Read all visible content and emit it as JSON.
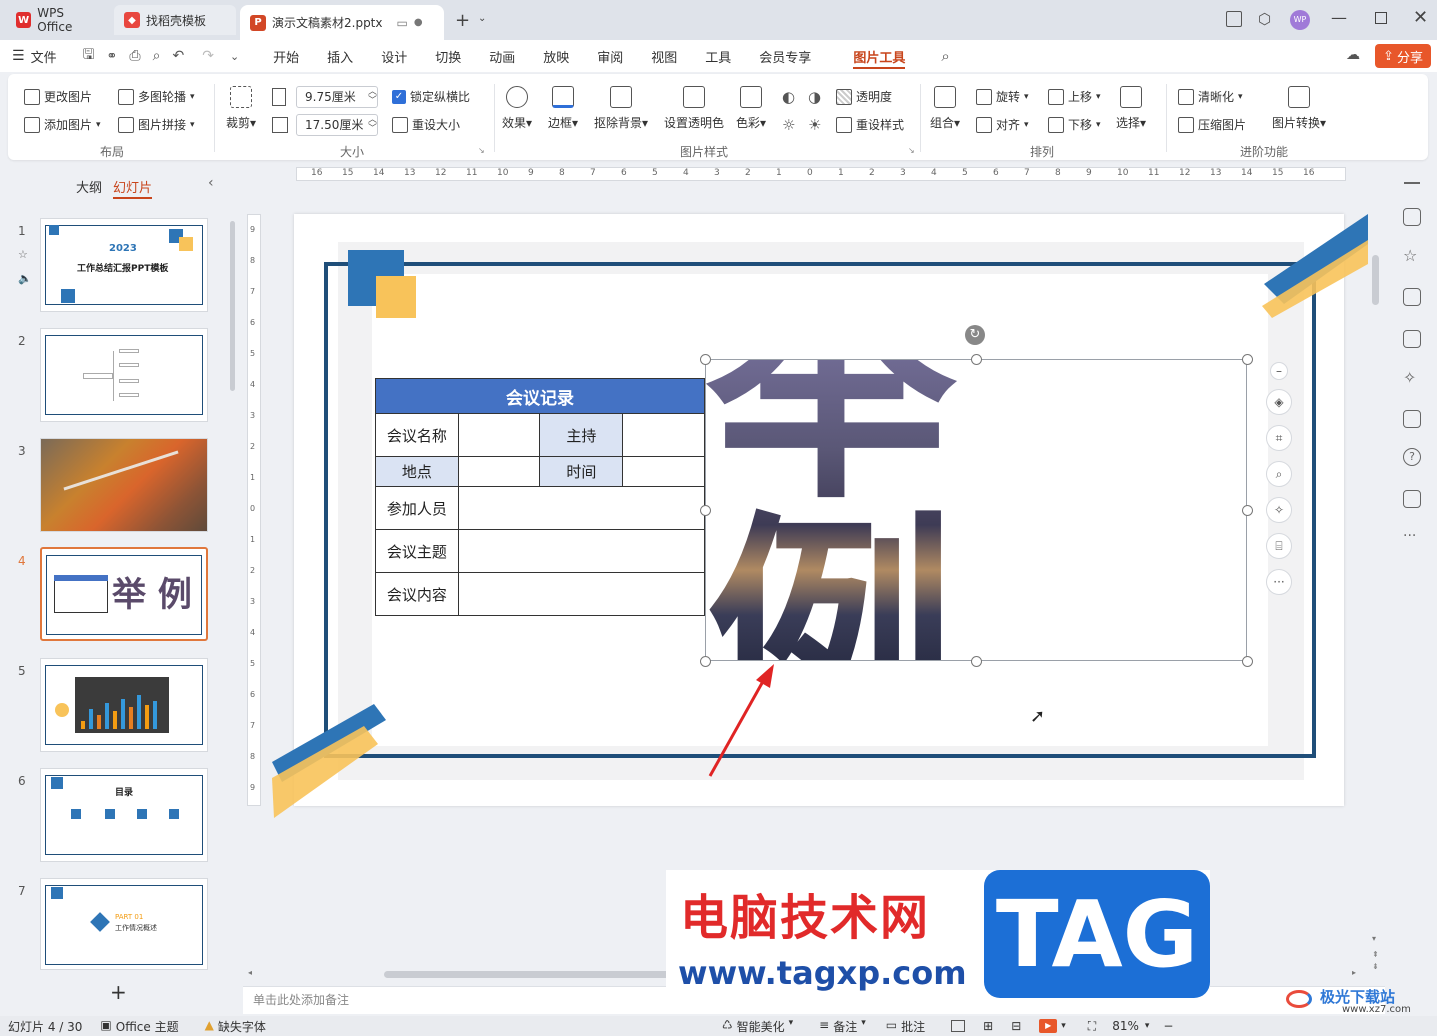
{
  "tabs": [
    {
      "label": "WPS Office"
    },
    {
      "label": "找稻壳模板"
    },
    {
      "label": "演示文稿素材2.pptx"
    }
  ],
  "user_badge": "WP",
  "menu": {
    "file": "文件",
    "items": [
      "开始",
      "插入",
      "设计",
      "切换",
      "动画",
      "放映",
      "审阅",
      "视图",
      "工具",
      "会员专享",
      "图片工具"
    ],
    "share": "分享"
  },
  "ribbon": {
    "change_image": "更改图片",
    "multi_carousel": "多图轮播",
    "add_image": "添加图片",
    "image_collage": "图片拼接",
    "layout_group": "布局",
    "crop": "裁剪",
    "width": "9.75厘米",
    "height": "17.50厘米",
    "lock_ratio": "锁定纵横比",
    "reset_size": "重设大小",
    "size_group": "大小",
    "effect": "效果",
    "border": "边框",
    "remove_bg": "抠除背景",
    "set_transparent": "设置透明色",
    "color": "色彩",
    "transparency": "透明度",
    "reset_style": "重设样式",
    "style_group": "图片样式",
    "group": "组合",
    "rotate": "旋转",
    "align": "对齐",
    "move_up": "上移",
    "move_down": "下移",
    "select": "选择",
    "arrange_group": "排列",
    "sharpen": "清晰化",
    "compress": "压缩图片",
    "convert": "图片转换",
    "advanced_group": "进阶功能"
  },
  "panel": {
    "outline": "大纲",
    "slides": "幻灯片"
  },
  "thumbs": [
    {
      "num": "1",
      "title": "工作总结汇报PPT模板",
      "year": "2023"
    },
    {
      "num": "2"
    },
    {
      "num": "3"
    },
    {
      "num": "4",
      "text": "举 例"
    },
    {
      "num": "5"
    },
    {
      "num": "6",
      "title": "目录"
    },
    {
      "num": "7",
      "title": "PART 01",
      "subtitle": "工作情况概述"
    }
  ],
  "ruler_labels": [
    "16",
    "15",
    "14",
    "13",
    "12",
    "11",
    "10",
    "9",
    "8",
    "7",
    "6",
    "5",
    "4",
    "3",
    "2",
    "1",
    "0",
    "1",
    "2",
    "3",
    "4",
    "5",
    "6",
    "7",
    "8",
    "9",
    "10",
    "11",
    "12",
    "13",
    "14",
    "15",
    "16"
  ],
  "vruler_labels": [
    "9",
    "8",
    "7",
    "6",
    "5",
    "4",
    "3",
    "2",
    "1",
    "0",
    "1",
    "2",
    "3",
    "4",
    "5",
    "6",
    "7",
    "8",
    "9"
  ],
  "slide": {
    "table_title": "会议记录",
    "rows": [
      [
        "会议名称",
        "",
        "主持",
        ""
      ],
      [
        "地点",
        "",
        "时间",
        ""
      ],
      [
        "参加人员",
        ""
      ],
      [
        "会议主题",
        ""
      ],
      [
        "会议内容",
        ""
      ]
    ],
    "art_text": "举  例"
  },
  "notes_placeholder": "单击此处添加备注",
  "watermark": {
    "cn": "电脑技术网",
    "url": "www.tagxp.com",
    "tag": "TAG",
    "corner": "极光下载站",
    "corner_url": "www.xz7.com"
  },
  "status": {
    "slide_pos": "幻灯片 4 / 30",
    "theme": "Office 主题",
    "missing_font": "缺失字体",
    "beautify": "智能美化",
    "notes": "备注",
    "comments": "批注",
    "zoom": "81%"
  },
  "colors": {
    "accent": "#c8451c",
    "table_header": "#4472c4",
    "table_cell": "#dae3f3",
    "frame": "#1f4e79",
    "slide_blue": "#2e75b6",
    "slide_yellow": "#f8c35a"
  }
}
